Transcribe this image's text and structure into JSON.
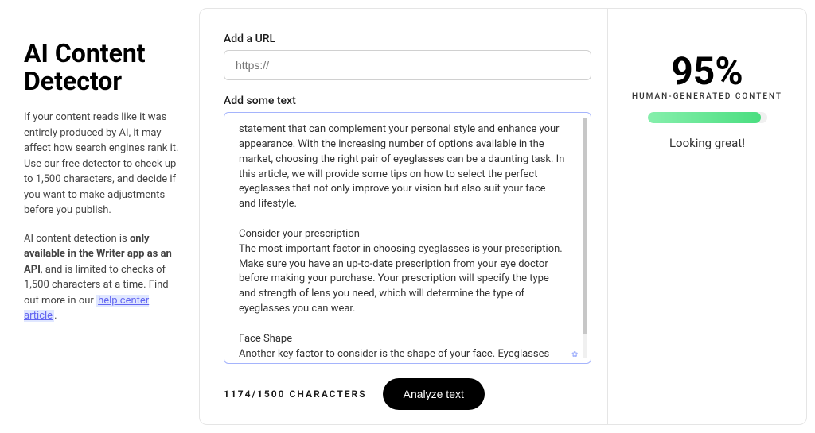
{
  "sidebar": {
    "title": "AI Content Detector",
    "desc1": "If your content reads like it was entirely produced by AI, it may affect how search engines rank it. Use our free detector to check up to 1,500 characters, and decide if you want to make adjustments before you publish.",
    "desc2_pre": "AI content detection is ",
    "desc2_bold": "only available in the Writer app as an API",
    "desc2_mid": ", and is limited to checks of 1,500 characters at a time. Find out more in our ",
    "desc2_link": "help center article",
    "desc2_post": "."
  },
  "form": {
    "url_label": "Add a URL",
    "url_placeholder": "https://",
    "text_label": "Add some text",
    "text_content": "statement that can complement your personal style and enhance your appearance. With the increasing number of options available in the market, choosing the right pair of eyeglasses can be a daunting task. In this article, we will provide some tips on how to select the perfect eyeglasses that not only improve your vision but also suit your face and lifestyle.\n\nConsider your prescription\nThe most important factor in choosing eyeglasses is your prescription. Make sure you have an up-to-date prescription from your eye doctor before making your purchase. Your prescription will specify the type and strength of lens you need, which will determine the type of eyeglasses you can wear.\n\nFace Shape\nAnother key factor to consider is the shape of your face. Eyeglasses come in various shapes and sizes, and the right frame can complement your facial features. If you have a round face, opt for square or rectangular frames to give your face more definition. If you have an oval face, any shape frame will suit you. If you have a square face, go for rounded frames to soften the angles of your face.",
    "char_count": "1174/1500 CHARACTERS",
    "analyze_button": "Analyze text"
  },
  "results": {
    "score": "95%",
    "label": "HUMAN-GENERATED CONTENT",
    "status": "Looking great!",
    "percent": 95
  }
}
